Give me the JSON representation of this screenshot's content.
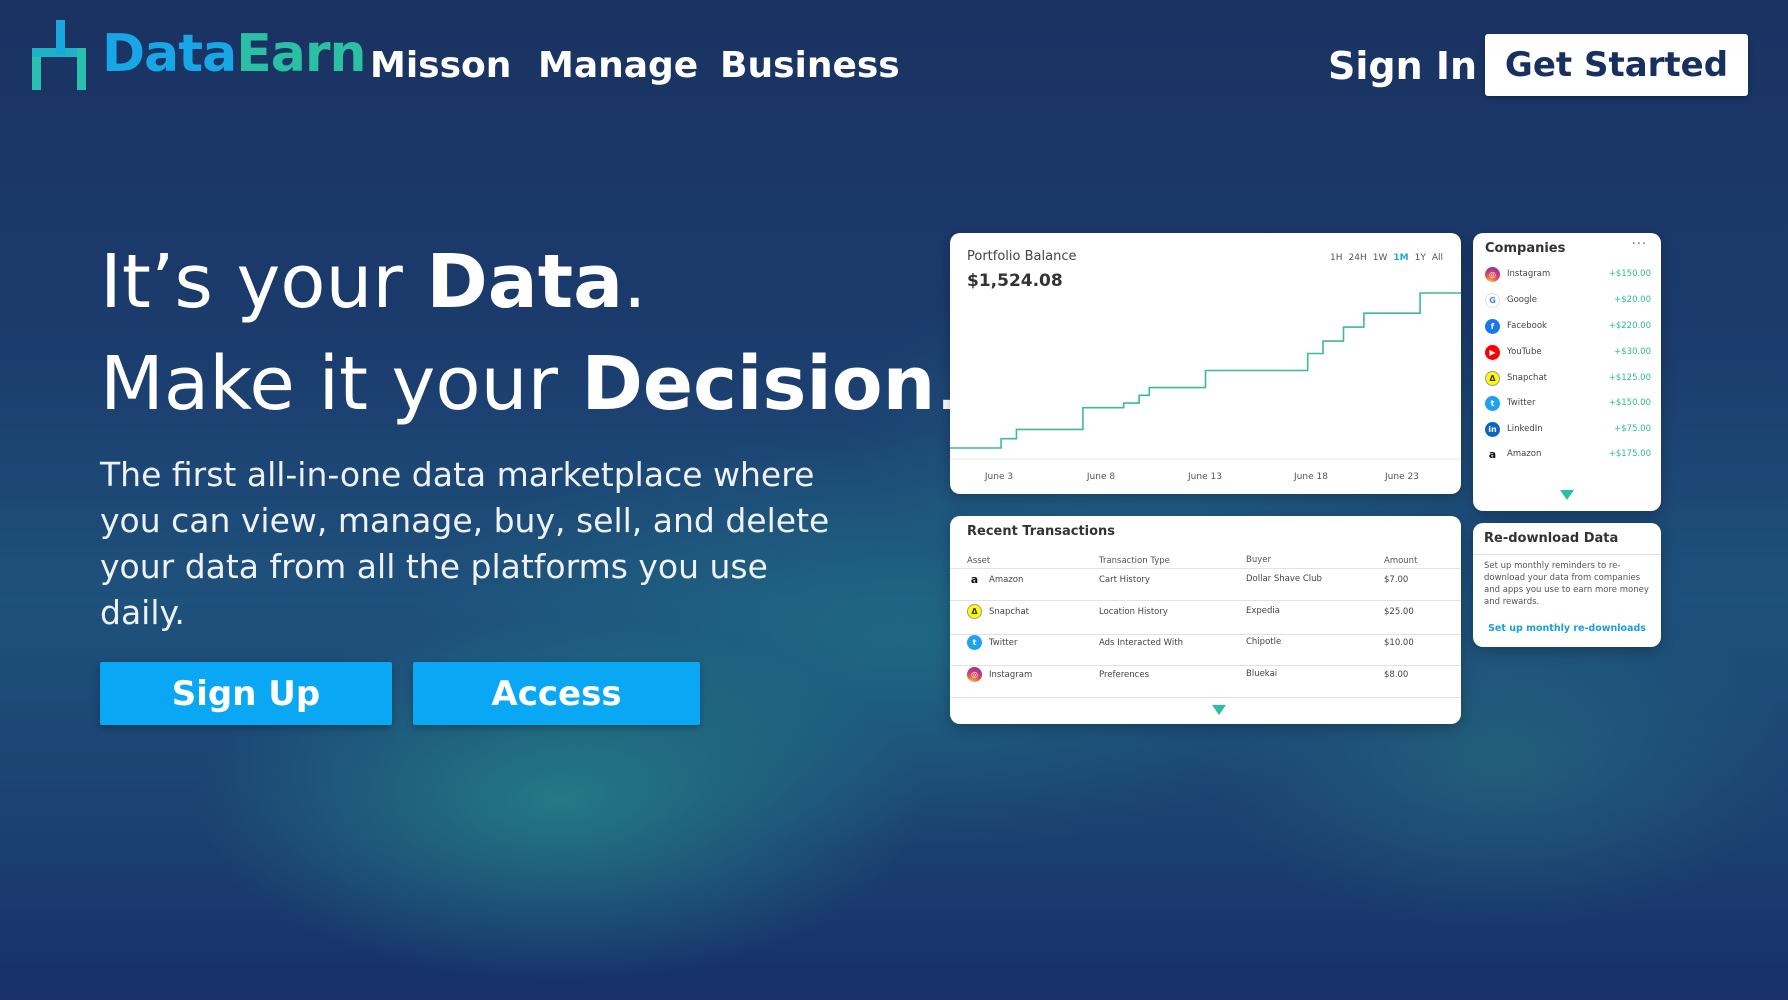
{
  "nav": {
    "logo": {
      "part1": "Data",
      "part2": "Earn"
    },
    "links": [
      "Misson",
      "Manage",
      "Business"
    ],
    "sign_in": "Sign In",
    "get_started": "Get Started"
  },
  "hero": {
    "line1_prefix": "It’s your ",
    "line1_bold": "Data",
    "line1_suffix": ".",
    "line2_prefix": "Make it your ",
    "line2_bold": "Decision",
    "line2_suffix": ".",
    "description": "The first all-in-one data marketplace where you can view, manage, buy, sell, and delete your data from all the platforms you use daily.",
    "signup_button": "Sign Up",
    "access_button": "Access"
  },
  "portfolio": {
    "label": "Portfolio Balance",
    "value": "$1,524.08",
    "ranges": [
      "1H",
      "24H",
      "1W",
      "1M",
      "1Y",
      "All"
    ],
    "active_range": "1M",
    "x_labels": [
      "June 3",
      "June 8",
      "June 13",
      "June 18",
      "June 23"
    ]
  },
  "chart_data": {
    "type": "line",
    "title": "Portfolio Balance",
    "x_labels": [
      "June 3",
      "June 8",
      "June 13",
      "June 18",
      "June 23"
    ],
    "line_color": "#3dbb8f",
    "step_points": [
      [
        0,
        0.0
      ],
      [
        0.5,
        0.0
      ],
      [
        0.5,
        0.06
      ],
      [
        0.65,
        0.06
      ],
      [
        0.65,
        0.12
      ],
      [
        1.3,
        0.12
      ],
      [
        1.3,
        0.26
      ],
      [
        1.7,
        0.26
      ],
      [
        1.7,
        0.29
      ],
      [
        1.85,
        0.29
      ],
      [
        1.85,
        0.34
      ],
      [
        1.95,
        0.34
      ],
      [
        1.95,
        0.39
      ],
      [
        2.5,
        0.39
      ],
      [
        2.5,
        0.5
      ],
      [
        3.5,
        0.5
      ],
      [
        3.5,
        0.61
      ],
      [
        3.65,
        0.61
      ],
      [
        3.65,
        0.69
      ],
      [
        3.85,
        0.69
      ],
      [
        3.85,
        0.78
      ],
      [
        4.05,
        0.78
      ],
      [
        4.05,
        0.87
      ],
      [
        4.6,
        0.87
      ],
      [
        4.6,
        1.0
      ],
      [
        5.0,
        1.0
      ]
    ]
  },
  "companies": {
    "title": "Companies",
    "menu": "···",
    "items": [
      {
        "name": "Instagram",
        "amount": "+$150.00",
        "icon": "instagram-icon",
        "glyph": "◎",
        "cls": "i-instagram"
      },
      {
        "name": "Google",
        "amount": "+$20.00",
        "icon": "google-icon",
        "glyph": "G",
        "cls": "i-google"
      },
      {
        "name": "Facebook",
        "amount": "+$220.00",
        "icon": "facebook-icon",
        "glyph": "f",
        "cls": "i-facebook"
      },
      {
        "name": "YouTube",
        "amount": "+$30.00",
        "icon": "youtube-icon",
        "glyph": "▶",
        "cls": "i-youtube"
      },
      {
        "name": "Snapchat",
        "amount": "+$125.00",
        "icon": "snapchat-icon",
        "glyph": "Δ",
        "cls": "i-snapchat"
      },
      {
        "name": "Twitter",
        "amount": "+$150.00",
        "icon": "twitter-icon",
        "glyph": "t",
        "cls": "i-twitter"
      },
      {
        "name": "LinkedIn",
        "amount": "+$75.00",
        "icon": "linkedin-icon",
        "glyph": "in",
        "cls": "i-linkedin"
      },
      {
        "name": "Amazon",
        "amount": "+$175.00",
        "icon": "amazon-icon",
        "glyph": "a",
        "cls": "i-amazon"
      }
    ]
  },
  "redownload": {
    "title": "Re-download Data",
    "description": "Set up monthly reminders to re-download your data from companies and apps you use to earn more money and rewards.",
    "link": "Set up monthly re-downloads"
  },
  "transactions": {
    "title": "Recent Transactions",
    "columns": [
      "Asset",
      "Transaction Type",
      "Buyer",
      "Amount"
    ],
    "rows": [
      {
        "asset": "Amazon",
        "type": "Cart History",
        "buyer": "Dollar Shave Club",
        "amount": "$7.00",
        "icon": "amazon-icon",
        "glyph": "a",
        "cls": "i-amazon"
      },
      {
        "asset": "Snapchat",
        "type": "Location History",
        "buyer": "Expedia",
        "amount": "$25.00",
        "icon": "snapchat-icon",
        "glyph": "Δ",
        "cls": "i-snapchat"
      },
      {
        "asset": "Twitter",
        "type": "Ads Interacted With",
        "buyer": "Chipotle",
        "amount": "$10.00",
        "icon": "twitter-icon",
        "glyph": "t",
        "cls": "i-twitter"
      },
      {
        "asset": "Instagram",
        "type": "Preferences",
        "buyer": "Bluekai",
        "amount": "$8.00",
        "icon": "instagram-icon",
        "glyph": "◎",
        "cls": "i-instagram"
      }
    ]
  },
  "colors": {
    "accent_button": "#0aa7f5",
    "logo_blue": "#19a6e6",
    "logo_teal": "#2bbfa4",
    "positive_amount": "#2bbf8a"
  }
}
